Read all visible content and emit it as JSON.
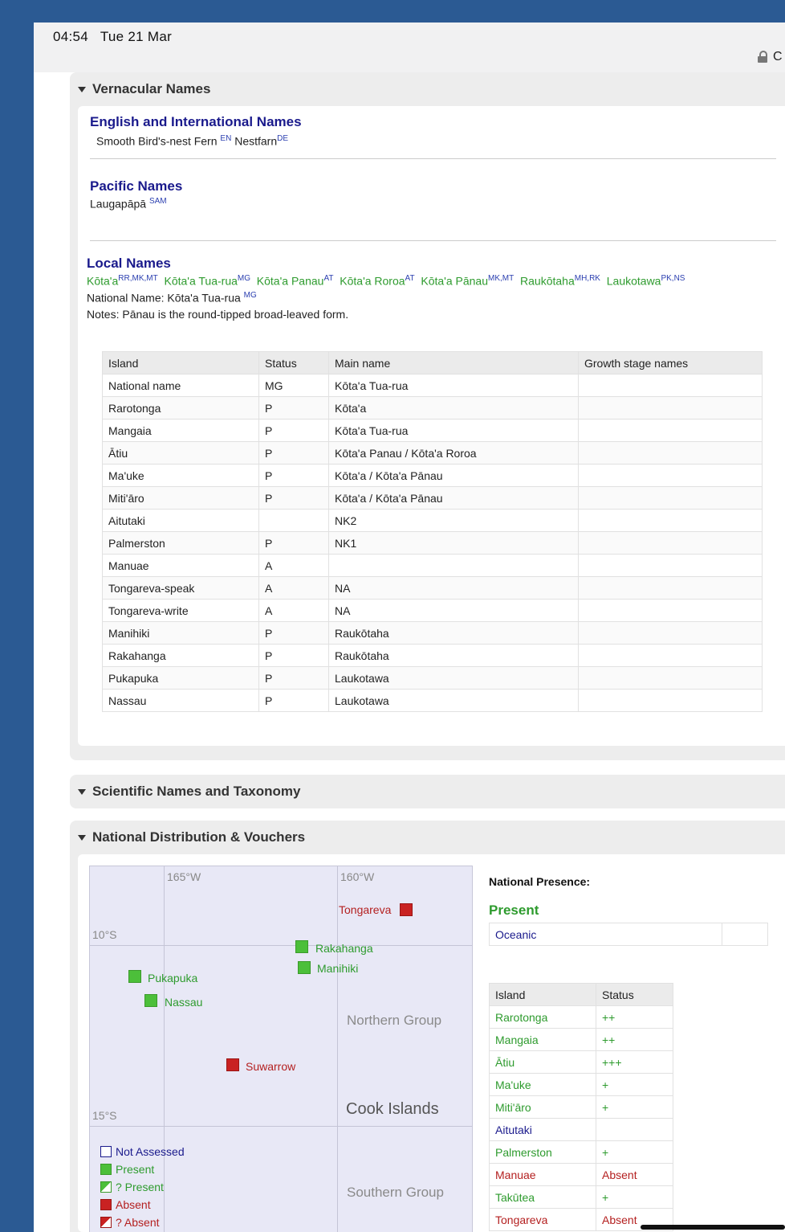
{
  "status": {
    "time": "04:54",
    "date": "Tue 21 Mar",
    "url_partial": "C"
  },
  "vernacular": {
    "title": "Vernacular Names",
    "english_heading": "English and International Names",
    "english_1": "Smooth Bird's-nest Fern",
    "english_1_sup": "EN",
    "english_2": "Nestfarn",
    "english_2_sup": "DE",
    "pacific_heading": "Pacific Names",
    "pacific_1": "Laugapāpā",
    "pacific_1_sup": "SAM",
    "local_heading": "Local Names",
    "local_names": [
      {
        "name": "Kōta'a",
        "sup": "RR,MK,MT"
      },
      {
        "name": "Kōta'a Tua-rua",
        "sup": "MG"
      },
      {
        "name": "Kōta'a Panau",
        "sup": "AT"
      },
      {
        "name": "Kōta'a Roroa",
        "sup": "AT"
      },
      {
        "name": "Kōta'a Pānau",
        "sup": "MK,MT"
      },
      {
        "name": "Raukōtaha",
        "sup": "MH,RK"
      },
      {
        "name": "Laukotawa",
        "sup": "PK,NS"
      }
    ],
    "national_name_label": "National Name: Kōta'a Tua-rua",
    "national_name_sup": "MG",
    "notes": "Notes: Pānau is the round-tipped broad-leaved form.",
    "table_headers": [
      "Island",
      "Status",
      "Main name",
      "Growth stage names"
    ],
    "table_rows": [
      [
        "National name",
        "MG",
        "Kōta'a Tua-rua",
        ""
      ],
      [
        "Rarotonga",
        "P",
        "Kōta'a",
        ""
      ],
      [
        "Mangaia",
        "P",
        "Kōta'a Tua-rua",
        ""
      ],
      [
        "Ātiu",
        "P",
        "Kōta'a Panau / Kōta'a Roroa",
        ""
      ],
      [
        "Ma'uke",
        "P",
        "Kōta'a / Kōta'a Pānau",
        ""
      ],
      [
        "Miti'āro",
        "P",
        "Kōta'a / Kōta'a Pānau",
        ""
      ],
      [
        "Aitutaki",
        "",
        "NK2",
        ""
      ],
      [
        "Palmerston",
        "P",
        "NK1",
        ""
      ],
      [
        "Manuae",
        "A",
        "",
        ""
      ],
      [
        "Tongareva-speak",
        "A",
        "NA",
        ""
      ],
      [
        "Tongareva-write",
        "A",
        "NA",
        ""
      ],
      [
        "Manihiki",
        "P",
        "Raukōtaha",
        ""
      ],
      [
        "Rakahanga",
        "P",
        "Raukōtaha",
        ""
      ],
      [
        "Pukapuka",
        "P",
        "Laukotawa",
        ""
      ],
      [
        "Nassau",
        "P",
        "Laukotawa",
        ""
      ]
    ]
  },
  "scientific": {
    "title": "Scientific Names and Taxonomy"
  },
  "distribution": {
    "title": "National Distribution & Vouchers",
    "map": {
      "lon_165": "165°W",
      "lon_160": "160°W",
      "lat_10": "10°S",
      "lat_15": "15°S",
      "tongareva": "Tongareva",
      "rakahanga": "Rakahanga",
      "manihiki": "Manihiki",
      "pukapuka": "Pukapuka",
      "nassau": "Nassau",
      "suwarrow": "Suwarrow",
      "northern_group": "Northern Group",
      "cook_islands": "Cook Islands",
      "southern_group": "Southern Group",
      "legend": [
        "Not Assessed",
        "Present",
        "? Present",
        "Absent",
        "? Absent"
      ]
    },
    "national_presence_label": "National Presence:",
    "present_label": "Present",
    "oceanic": "Oceanic",
    "status_headers": [
      "Island",
      "Status"
    ],
    "status_rows": [
      {
        "island": "Rarotonga",
        "status": "++"
      },
      {
        "island": "Mangaia",
        "status": "++"
      },
      {
        "island": "Ātiu",
        "status": "+++"
      },
      {
        "island": "Ma'uke",
        "status": "+"
      },
      {
        "island": "Miti'āro",
        "status": "+"
      },
      {
        "island": "Aitutaki",
        "status": ""
      },
      {
        "island": "Palmerston",
        "status": "+"
      },
      {
        "island": "Manuae",
        "status": "Absent"
      },
      {
        "island": "Takūtea",
        "status": "+"
      },
      {
        "island": "Tongareva",
        "status": "Absent"
      }
    ]
  }
}
